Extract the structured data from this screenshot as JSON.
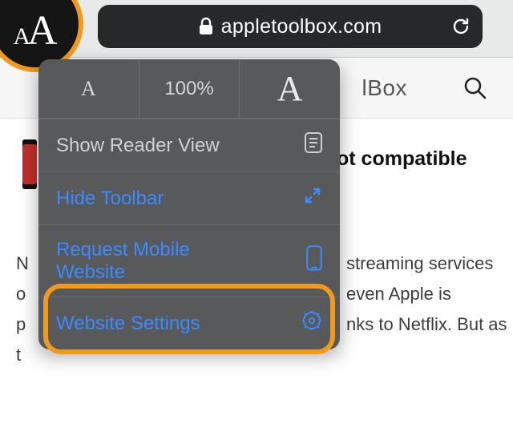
{
  "colors": {
    "accent_blue": "#3a8bff",
    "highlight_orange": "#f29a1c",
    "menu_bg": "#58595b"
  },
  "navbar": {
    "aa_small": "A",
    "aa_big": "A",
    "url": "appletoolbox.com"
  },
  "siteheader": {
    "brand_fragment": "lBox"
  },
  "article": {
    "headline_fragment": "ot compatible",
    "line1_left": "N",
    "line1_right": "streaming services",
    "line2_left": "o",
    "line2_right": "even Apple is",
    "line3_left": "p",
    "line3_right": "nks to Netflix. But as",
    "line4_left": "t"
  },
  "popover": {
    "zoom_small": "A",
    "zoom_value": "100%",
    "zoom_big": "A",
    "reader": "Show Reader View",
    "hide": "Hide Toolbar",
    "request": "Request Mobile Website",
    "settings": "Website Settings"
  }
}
